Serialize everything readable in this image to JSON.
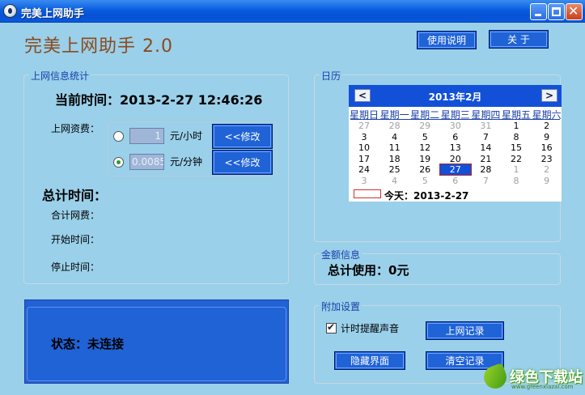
{
  "window": {
    "title": "完美上网助手"
  },
  "header": {
    "app_title": "完美上网助手 2.0",
    "help_button": "使用说明",
    "about_button": "关 于"
  },
  "stats": {
    "group_label": "上网信息统计",
    "current_time_label": "当前时间：2013-2-27 12:46:26",
    "fee_label": "上网资费：",
    "rate_hour": {
      "value": "1",
      "unit": "元/小时",
      "button": "<<修改",
      "checked": false
    },
    "rate_minute": {
      "value": "0.0085",
      "unit": "元/分钟",
      "button": "<<修改",
      "checked": true
    },
    "total_time_label": "总计时间：",
    "total_fee_label": "合计网费：",
    "start_time_label": "开始时间：",
    "stop_time_label": "停止时间："
  },
  "status": {
    "text": "状态：未连接"
  },
  "calendar": {
    "group_label": "日历",
    "month_title": "2013年2月",
    "prev": "<",
    "next": ">",
    "weekdays": [
      "星期日",
      "星期一",
      "星期二",
      "星期三",
      "星期四",
      "星期五",
      "星期六"
    ],
    "weeks": [
      [
        "27",
        "28",
        "29",
        "30",
        "31",
        "1",
        "2"
      ],
      [
        "3",
        "4",
        "5",
        "6",
        "7",
        "8",
        "9"
      ],
      [
        "10",
        "11",
        "12",
        "13",
        "14",
        "15",
        "16"
      ],
      [
        "17",
        "18",
        "19",
        "20",
        "21",
        "22",
        "23"
      ],
      [
        "24",
        "25",
        "26",
        "27",
        "28",
        "1",
        "2"
      ],
      [
        "3",
        "4",
        "5",
        "6",
        "7",
        "8",
        "9"
      ]
    ],
    "today_text": "今天：2013-2-27"
  },
  "amount": {
    "group_label": "金额信息",
    "total_used": "总计使用：0元"
  },
  "extra": {
    "group_label": "附加设置",
    "timer_sound_label": "计时提醒声音",
    "timer_sound_checked": true,
    "log_button": "上网记录",
    "hide_button": "隐藏界面",
    "clear_button": "清空记录"
  },
  "watermark": {
    "text": "绿色下载站",
    "sub": "www.greenxiazai.com"
  }
}
